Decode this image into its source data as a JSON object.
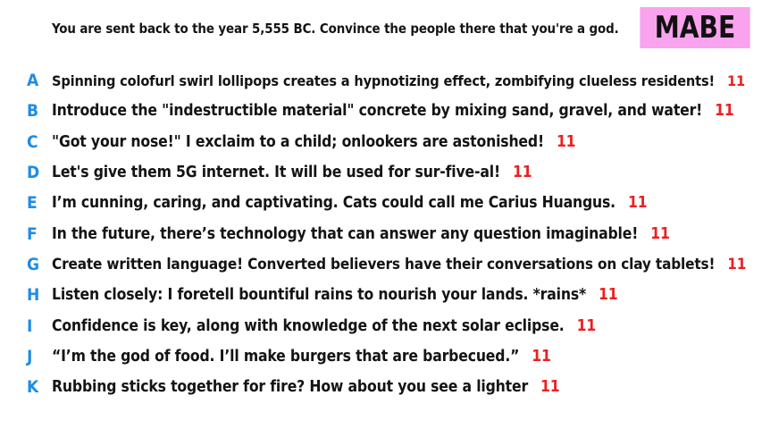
{
  "prompt": "You are sent back to the year 5,555 BC. Convince the people there that you're a god.",
  "badge": "MABE",
  "colors": {
    "letter": "#1f8ce6",
    "score": "#ea2020",
    "badge_bg": "#f9a3ee"
  },
  "answers": [
    {
      "letter": "A",
      "text": "Spinning colofurl swirl lollipops creates a hypnotizing effect, zombifying clueless residents!",
      "score": "11"
    },
    {
      "letter": "B",
      "text": "Introduce the \"indestructible material\" concrete by mixing sand, gravel, and water!",
      "score": "11"
    },
    {
      "letter": "C",
      "text": "\"Got your nose!\" I exclaim to a child; onlookers are astonished!",
      "score": "11"
    },
    {
      "letter": "D",
      "text": "Let's give them 5G internet. It will be used for sur-five-al!",
      "score": "11"
    },
    {
      "letter": "E",
      "text": "I’m cunning, caring, and captivating. Cats could call me Carius Huangus.",
      "score": "11"
    },
    {
      "letter": "F",
      "text": "In the future, there’s technology that can answer any question imaginable!",
      "score": "11"
    },
    {
      "letter": "G",
      "text": "Create written language! Converted believers have their conversations on clay tablets!",
      "score": "11"
    },
    {
      "letter": "H",
      "text": "Listen closely: I foretell bountiful rains to nourish your lands. *rains*",
      "score": "11"
    },
    {
      "letter": "I",
      "text": "Confidence is key, along with knowledge of the next solar eclipse.",
      "score": "11"
    },
    {
      "letter": "J",
      "text": "“I’m the god of food. I’ll make burgers that are barbecued.”",
      "score": "11"
    },
    {
      "letter": "K",
      "text": "Rubbing sticks together for fire? How about you see a lighter",
      "score": "11"
    }
  ]
}
